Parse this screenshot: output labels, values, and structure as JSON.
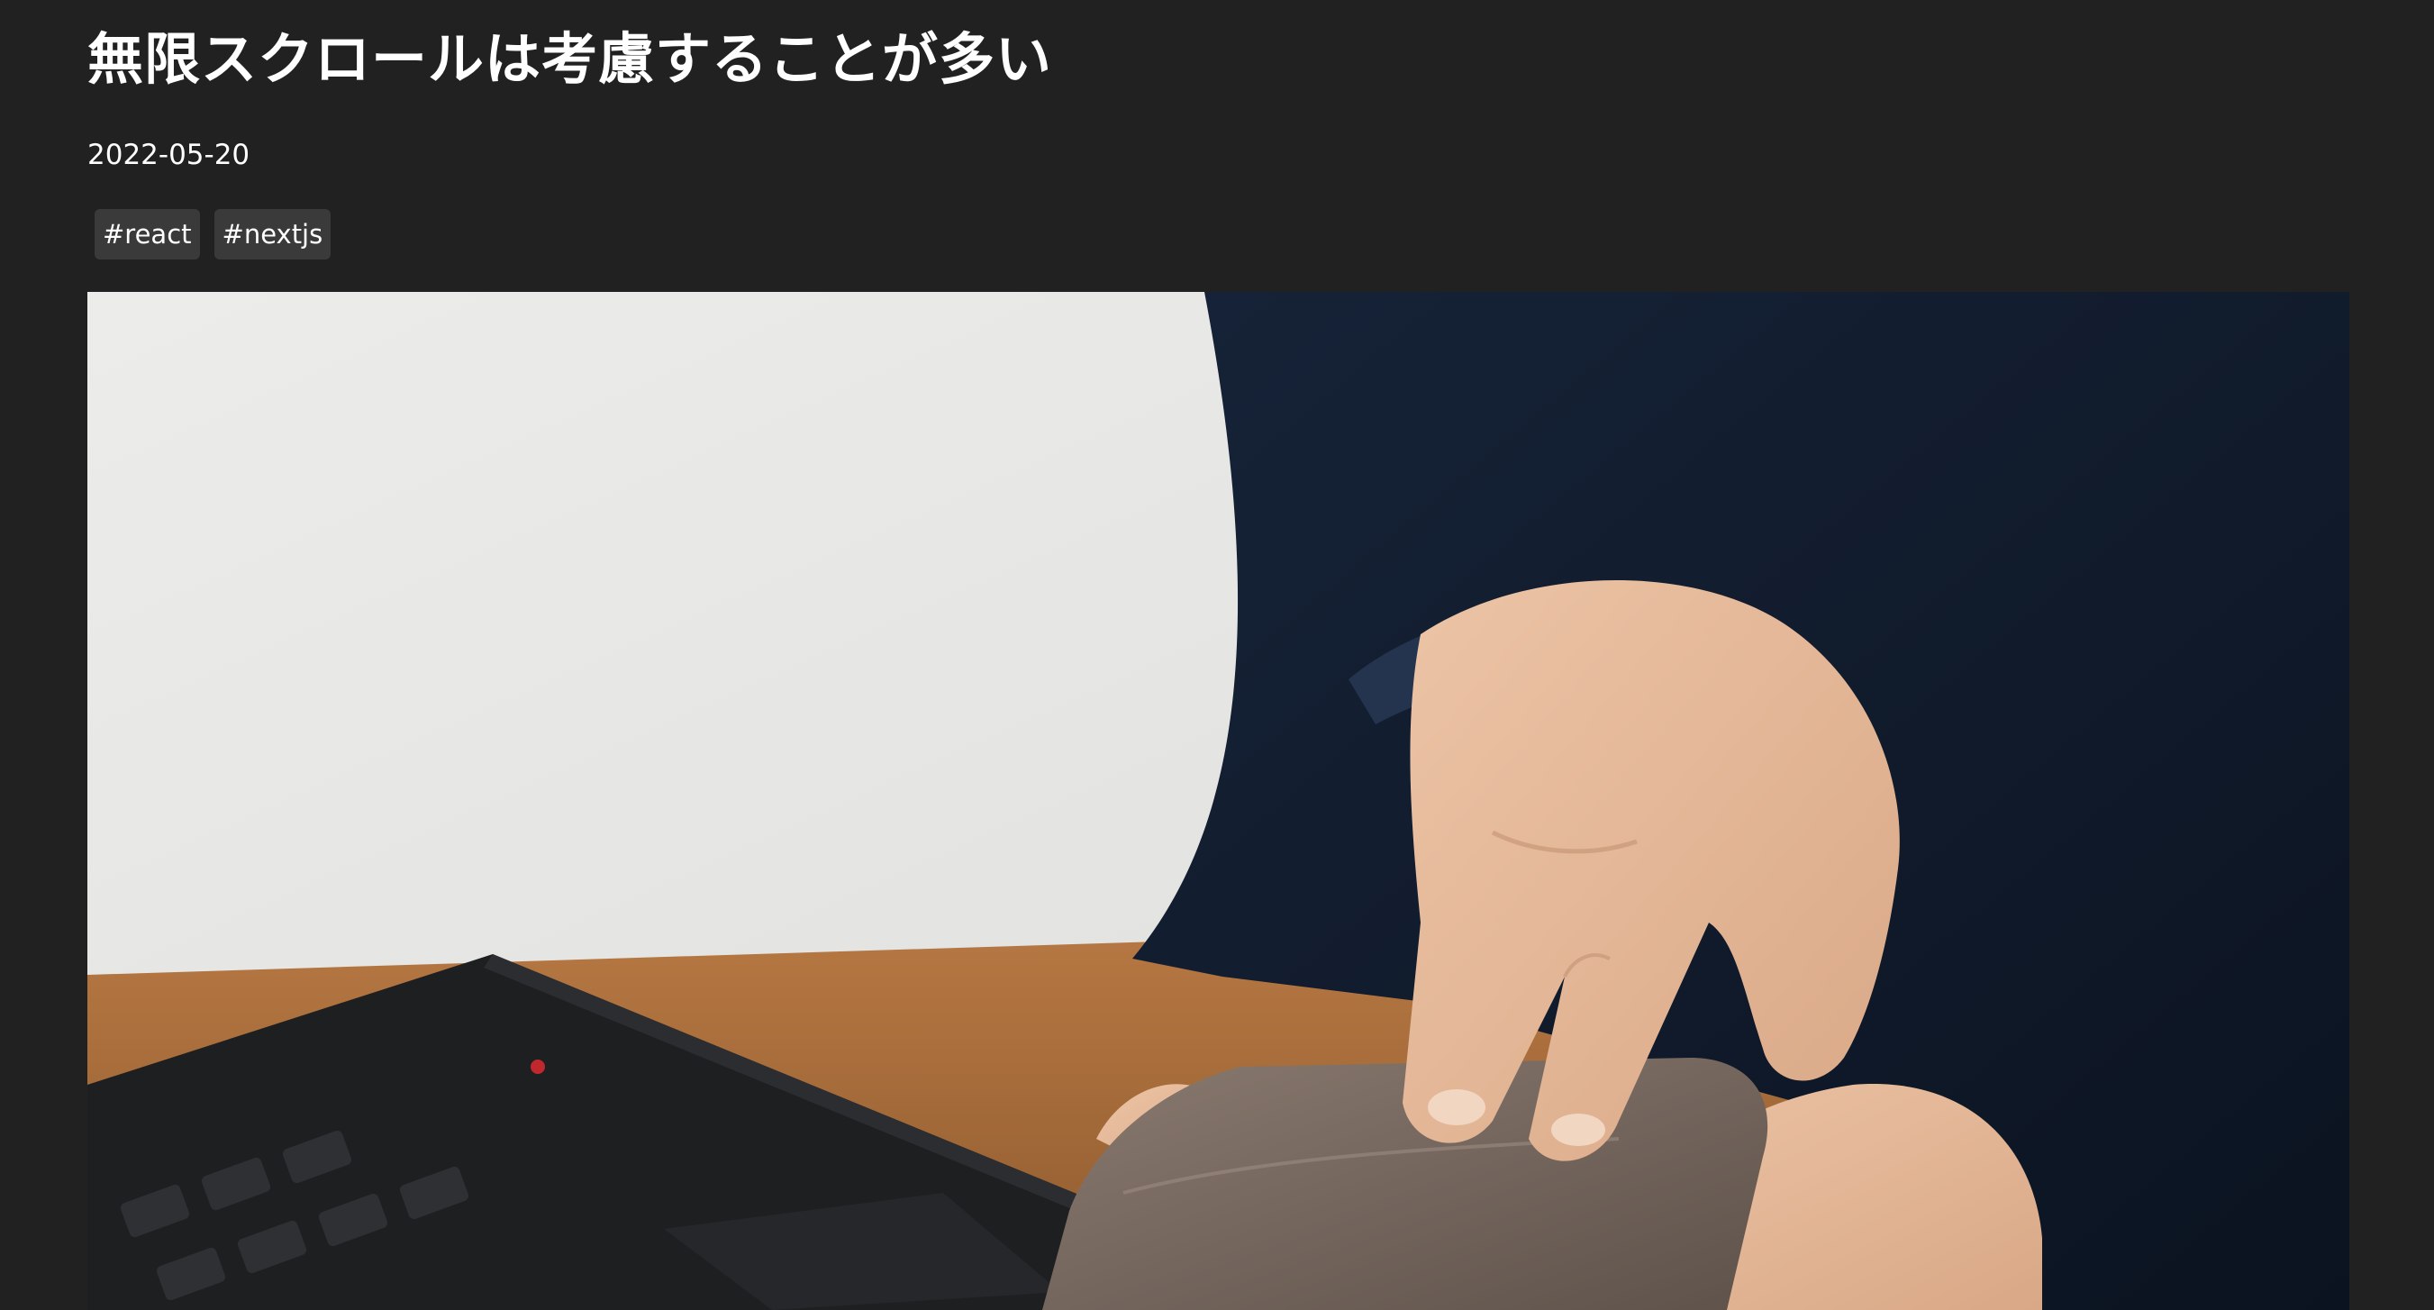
{
  "article": {
    "title": "無限スクロールは考慮することが多い",
    "date": "2022-05-20",
    "tags": [
      "#react",
      "#nextjs"
    ],
    "hero_image": {
      "alt": "person pressing a finger on a phone-sized brown block next to a black laptop keyboard"
    }
  },
  "colors": {
    "background": "#212121",
    "text": "#ffffff",
    "tag_background": "#3a3a3a"
  }
}
